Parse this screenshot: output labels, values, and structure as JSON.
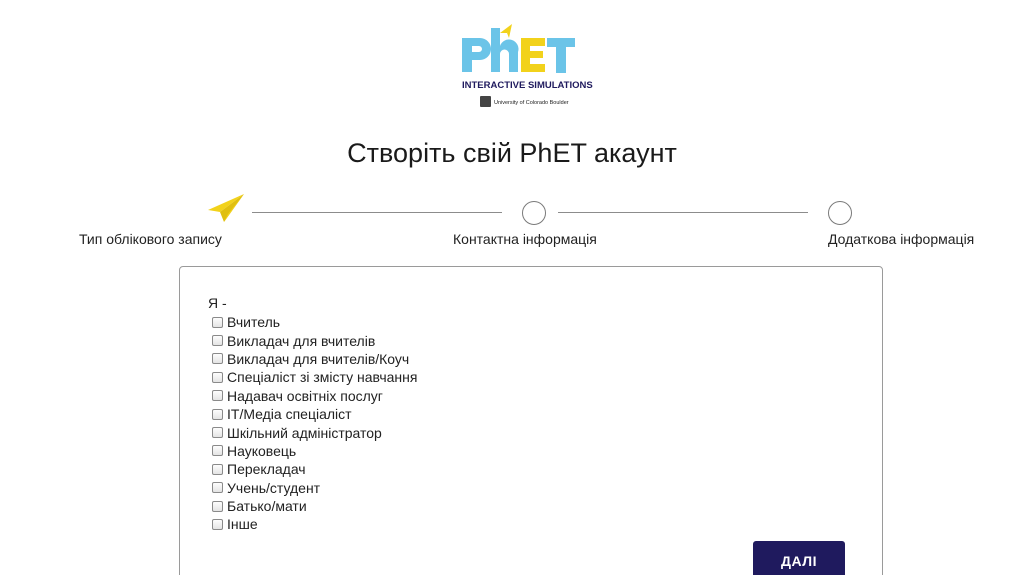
{
  "logo": {
    "wordmark": "PhET",
    "tagline": "INTERACTIVE SIMULATIONS",
    "university": "University of Colorado Boulder",
    "colors": {
      "ph": "#6bc4e8",
      "e": "#f2d21b",
      "t": "#6bc4e8",
      "text": "#1f1a5e"
    }
  },
  "page": {
    "title": "Створіть свій PhET акаунт"
  },
  "stepper": {
    "active_icon": "paper-plane-icon",
    "active_color": "#f2d21b",
    "steps": [
      {
        "label": "Тип облікового запису",
        "state": "active"
      },
      {
        "label": "Контактна інформація",
        "state": "pending"
      },
      {
        "label": "Додаткова інформація",
        "state": "pending"
      }
    ]
  },
  "form": {
    "heading": "Я -",
    "roles": [
      {
        "label": "Вчитель",
        "checked": false
      },
      {
        "label": "Викладач для вчителів",
        "checked": false
      },
      {
        "label": "Викладач для вчителів/Коуч",
        "checked": false
      },
      {
        "label": "Спеціаліст зі змісту навчання",
        "checked": false
      },
      {
        "label": "Надавач освітніх послуг",
        "checked": false
      },
      {
        "label": "IT/Медіа спеціаліст",
        "checked": false
      },
      {
        "label": "Шкільний адміністратор",
        "checked": false
      },
      {
        "label": "Науковець",
        "checked": false
      },
      {
        "label": "Перекладач",
        "checked": false
      },
      {
        "label": "Учень/студент",
        "checked": false
      },
      {
        "label": "Батько/мати",
        "checked": false
      },
      {
        "label": "Інше",
        "checked": false
      }
    ],
    "next_label": "ДАЛІ",
    "next_color": "#1f1a5e"
  }
}
